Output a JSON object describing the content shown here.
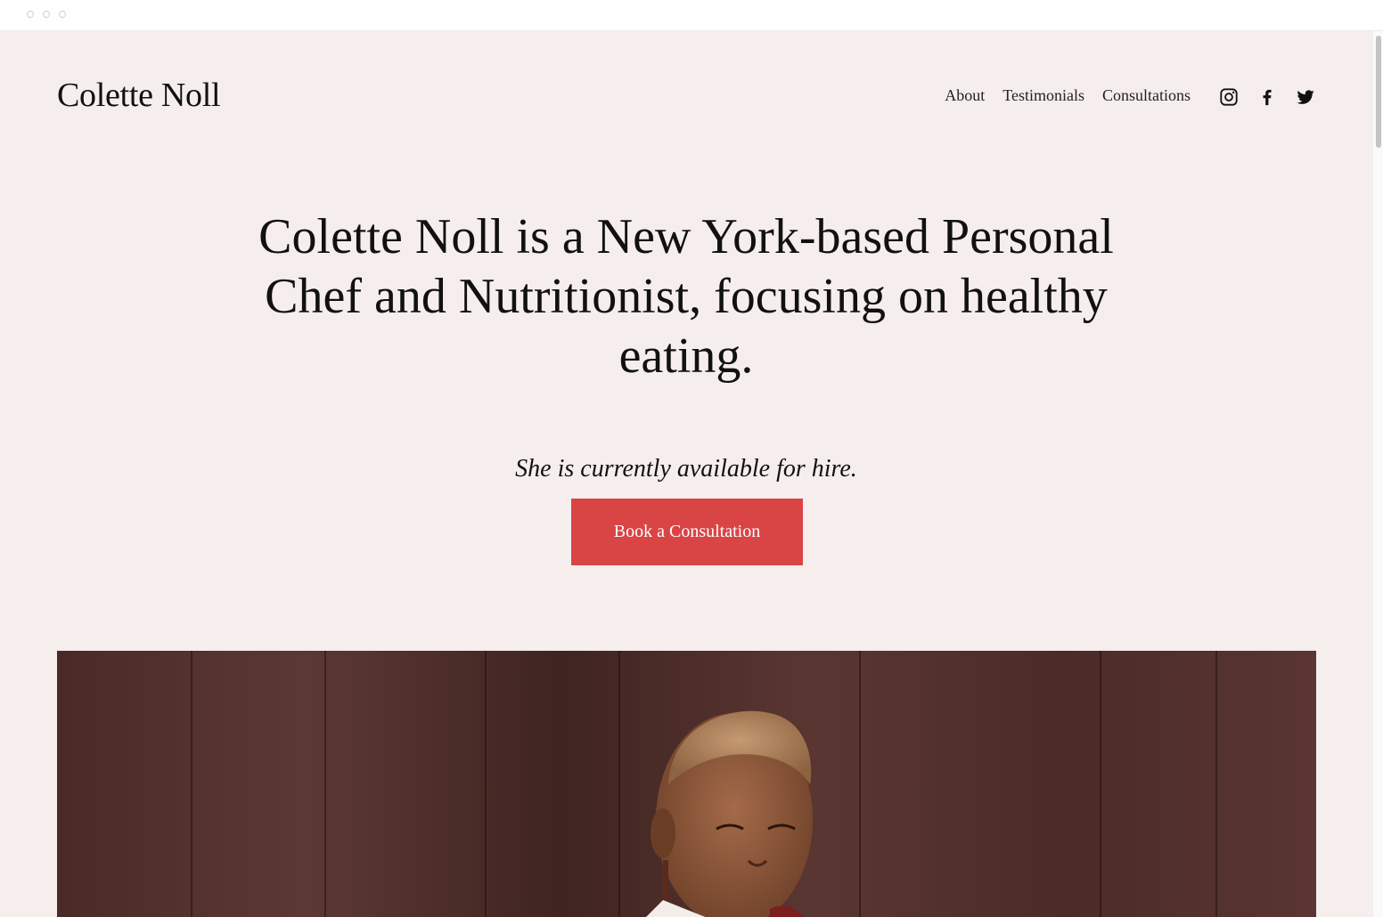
{
  "site": {
    "logo": "Colette Noll"
  },
  "nav": {
    "items": [
      {
        "label": "About"
      },
      {
        "label": "Testimonials"
      },
      {
        "label": "Consultations"
      }
    ]
  },
  "social": {
    "icons": [
      "instagram-icon",
      "facebook-icon",
      "twitter-icon"
    ]
  },
  "hero": {
    "headline": "Colette Noll is a New York-based Personal Chef and Nutritionist, focusing on healthy eating.",
    "subline": "She is currently available for hire.",
    "cta_label": "Book a Consultation"
  },
  "colors": {
    "page_background": "#f5eeec",
    "accent": "#d94545",
    "text": "#111111"
  }
}
